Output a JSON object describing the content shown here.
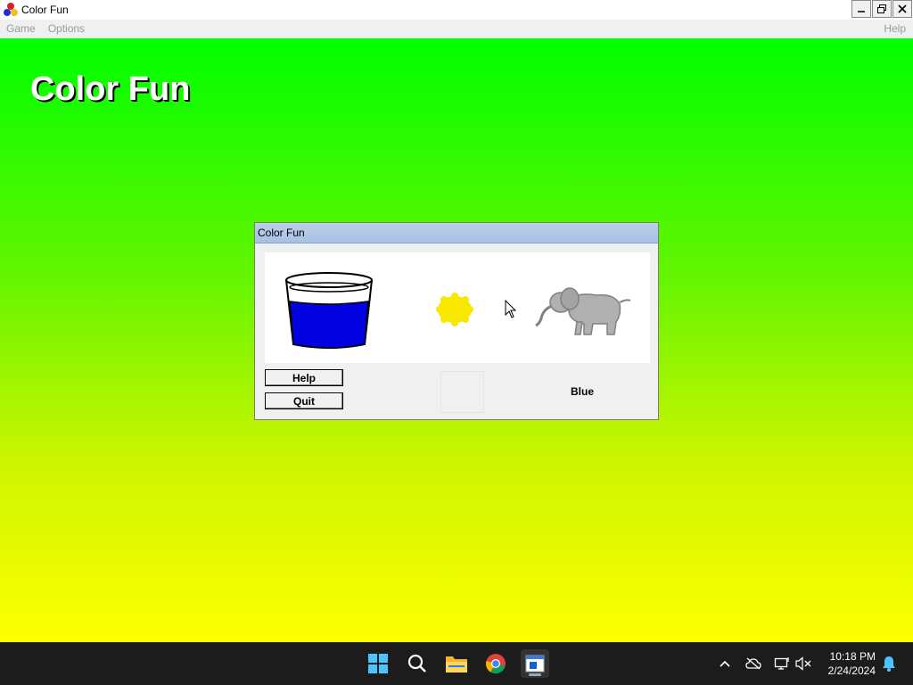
{
  "window": {
    "title": "Color Fun",
    "controls": {
      "minimize": "–",
      "restore": "❐",
      "close": "✕"
    }
  },
  "menu": {
    "items": [
      "Game",
      "Options"
    ],
    "help": "Help"
  },
  "canvas": {
    "heading": "Color Fun",
    "gradient_top": "#00ff00",
    "gradient_bottom": "#ffff00"
  },
  "dialog": {
    "title": "Color Fun",
    "pictures": [
      "blue-cup-icon",
      "yellow-sun-icon",
      "gray-elephant-icon"
    ],
    "help_button": "Help",
    "quit_button": "Quit",
    "color_name": "Blue"
  },
  "taskbar": {
    "icons": [
      "windows-start-icon",
      "search-icon",
      "file-explorer-icon",
      "chrome-icon",
      "color-fun-app-icon"
    ],
    "time": "10:18 PM",
    "date": "2/24/2024"
  }
}
